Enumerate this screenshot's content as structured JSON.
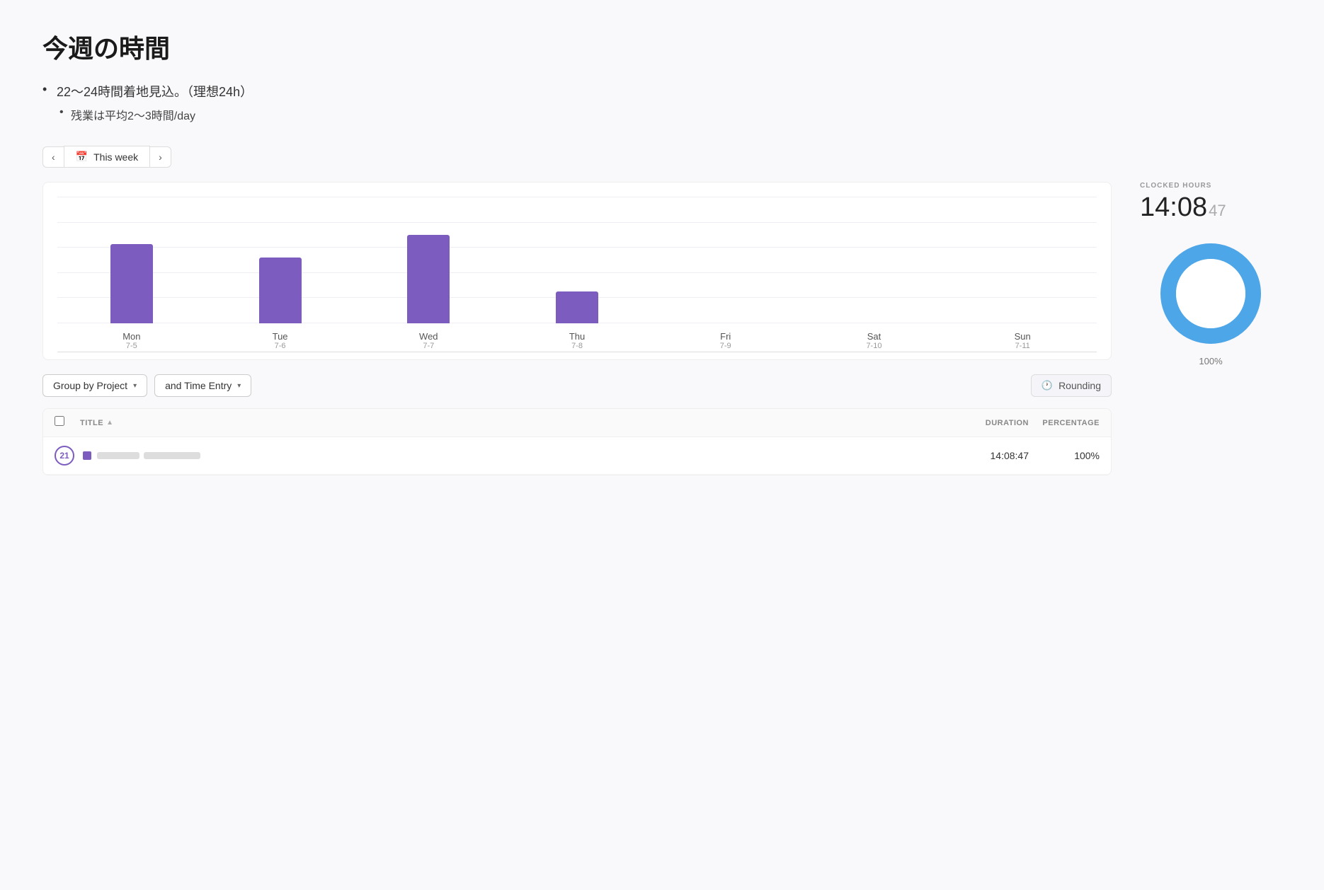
{
  "page": {
    "title": "今週の時間",
    "bullets": [
      {
        "text": "22〜24時間着地見込。（理想24h）",
        "sub": [
          "残業は平均2〜3時間/day"
        ]
      }
    ]
  },
  "week_nav": {
    "prev_label": "‹",
    "next_label": "›",
    "current_label": "This week",
    "calendar_icon": "📅"
  },
  "chart": {
    "days": [
      {
        "label": "Mon",
        "date": "7-5",
        "height_pct": 70
      },
      {
        "label": "Tue",
        "date": "7-6",
        "height_pct": 58
      },
      {
        "label": "Wed",
        "date": "7-7",
        "height_pct": 78
      },
      {
        "label": "Thu",
        "date": "7-8",
        "height_pct": 28
      },
      {
        "label": "Fri",
        "date": "7-9",
        "height_pct": 0
      },
      {
        "label": "Sat",
        "date": "7-10",
        "height_pct": 0
      },
      {
        "label": "Sun",
        "date": "7-11",
        "height_pct": 0
      }
    ]
  },
  "controls": {
    "group_by_label": "Group by Project",
    "time_entry_label": "and Time Entry",
    "rounding_label": "Rounding"
  },
  "table": {
    "headers": {
      "title": "TITLE",
      "duration": "DURATION",
      "percentage": "PERCENTAGE"
    },
    "rows": [
      {
        "badge": "21",
        "title_placeholder_widths": [
          60,
          80
        ],
        "duration": "14:08:47",
        "percentage": "100%"
      }
    ]
  },
  "right_panel": {
    "clocked_label": "CLOCKED HOURS",
    "clocked_main": "14:08",
    "clocked_sec": "47",
    "donut_percent": "100%",
    "donut_value": 100
  }
}
